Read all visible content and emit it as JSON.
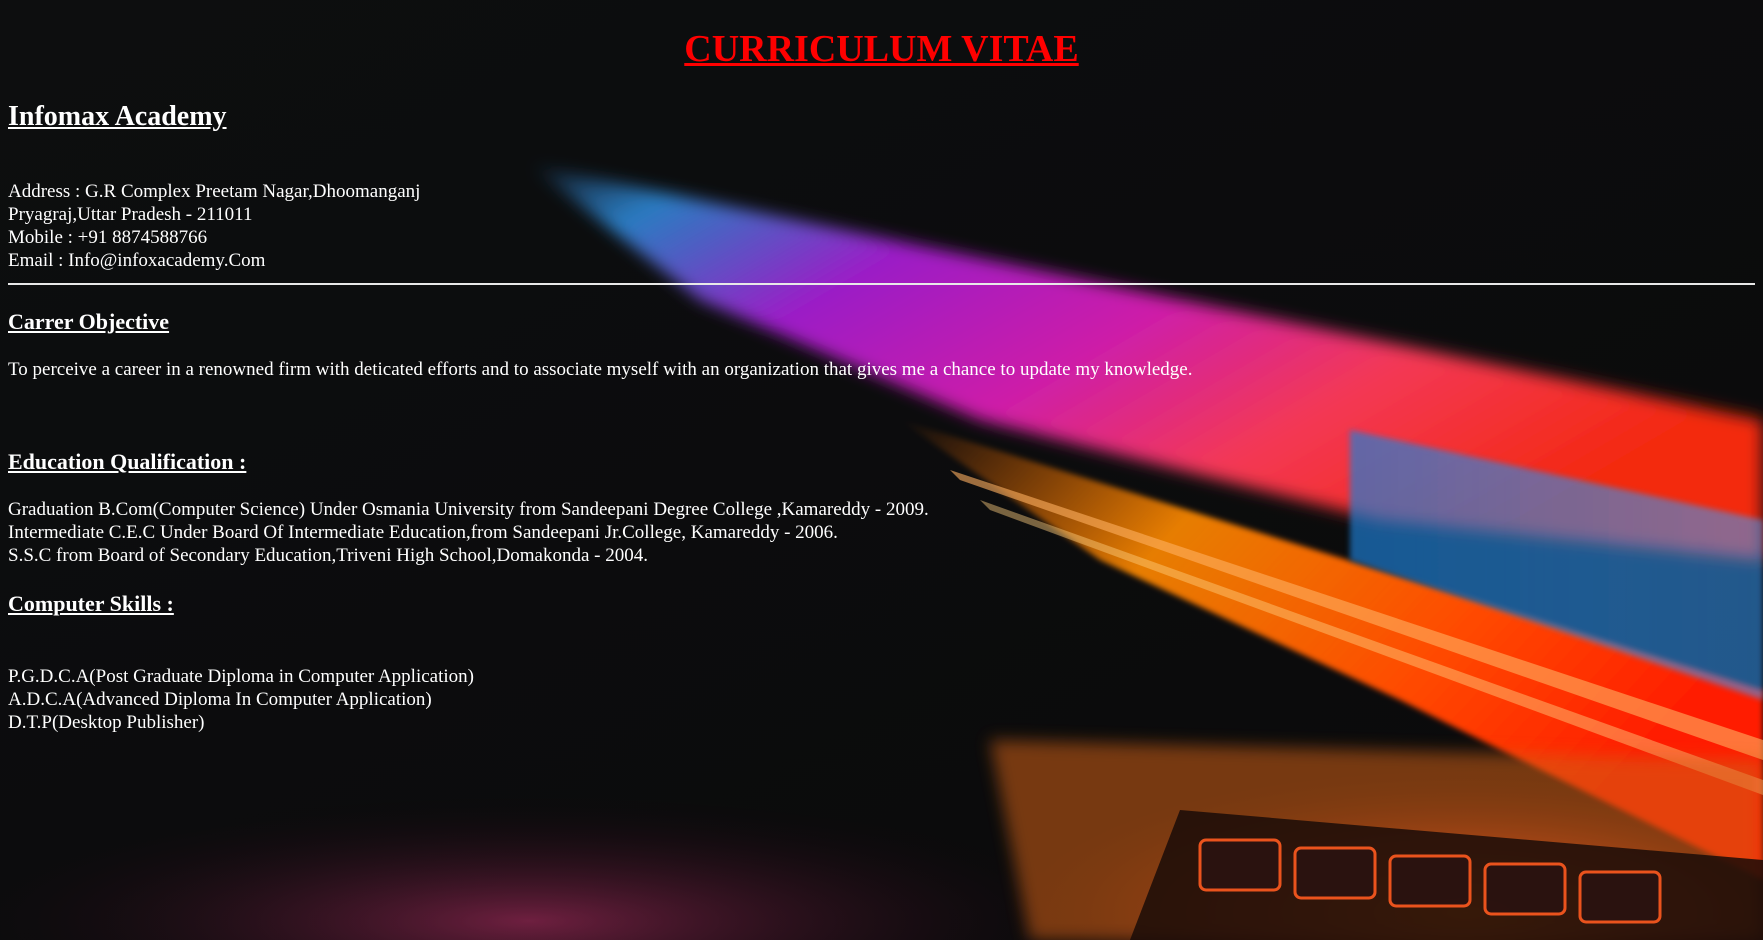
{
  "colors": {
    "title": "#ff0000",
    "text": "#ffffff",
    "background": "#0b0c0d",
    "divider": "#e8e8e8"
  },
  "title": "CURRICULUM VITAE",
  "organization": "Infomax Academy",
  "contact": {
    "address_line1": "Address : G.R Complex Preetam Nagar,Dhoomanganj",
    "address_line2": "Pryagraj,Uttar Pradesh - 211011",
    "mobile": "Mobile : +91 8874588766",
    "email": "Email : Info@infoxacademy.Com"
  },
  "career_objective": {
    "heading": "Carrer Objective",
    "text": "To perceive a career in a renowned firm with deticated efforts and to associate myself with an organization that gives me a chance to update my knowledge."
  },
  "education": {
    "heading": "Education Qualification :",
    "items": [
      "Graduation B.Com(Computer Science) Under Osmania University from Sandeepani Degree College ,Kamareddy - 2009.",
      "Intermediate C.E.C Under Board Of Intermediate Education,from Sandeepani Jr.College, Kamareddy - 2006.",
      "S.S.C from Board of Secondary Education,Triveni High School,Domakonda - 2004."
    ]
  },
  "computer_skills": {
    "heading": "Computer Skills :",
    "items": [
      "P.G.D.C.A(Post Graduate Diploma in Computer Application)",
      "A.D.C.A(Advanced Diploma In Computer Application)",
      "D.T.P(Desktop Publisher)"
    ]
  }
}
